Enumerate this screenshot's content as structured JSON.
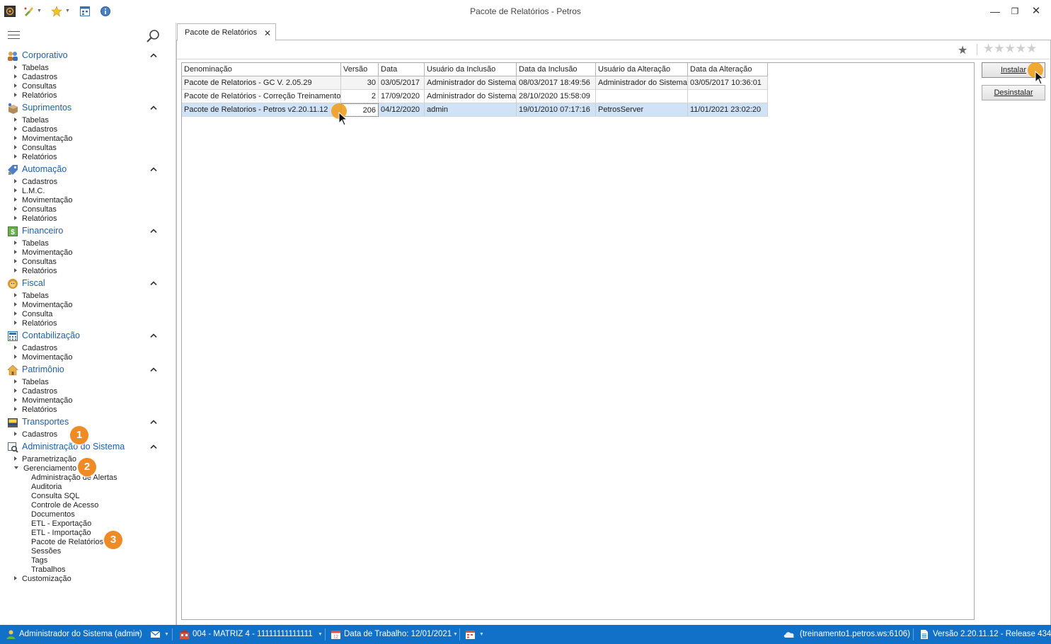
{
  "window": {
    "title": "Pacote de Relatórios - Petros"
  },
  "toolbar": {
    "icons": [
      "app-logo-icon",
      "brush-icon",
      "favorites-star-icon",
      "calendar-grid-icon",
      "info-icon"
    ]
  },
  "sidebar": {
    "groups": [
      {
        "name": "corporativo",
        "label": "Corporativo",
        "icon": "people-icon",
        "items": [
          "Tabelas",
          "Cadastros",
          "Consultas",
          "Relatórios"
        ]
      },
      {
        "name": "suprimentos",
        "label": "Suprimentos",
        "icon": "box-icon",
        "items": [
          "Tabelas",
          "Cadastros",
          "Movimentação",
          "Consultas",
          "Relatórios"
        ]
      },
      {
        "name": "automacao",
        "label": "Automação",
        "icon": "tag-icon",
        "items": [
          "Cadastros",
          "L.M.C.",
          "Movimentação",
          "Consultas",
          "Relatórios"
        ]
      },
      {
        "name": "financeiro",
        "label": "Financeiro",
        "icon": "money-icon",
        "items": [
          "Tabelas",
          "Movimentação",
          "Consultas",
          "Relatórios"
        ]
      },
      {
        "name": "fiscal",
        "label": "Fiscal",
        "icon": "lion-icon",
        "items": [
          "Tabelas",
          "Movimentação",
          "Consulta",
          "Relatórios"
        ]
      },
      {
        "name": "contabilizacao",
        "label": "Contabilização",
        "icon": "calculator-icon",
        "items": [
          "Cadastros",
          "Movimentação"
        ]
      },
      {
        "name": "patrimonio",
        "label": "Patrimônio",
        "icon": "house-icon",
        "items": [
          "Tabelas",
          "Cadastros",
          "Movimentação",
          "Relatórios"
        ]
      },
      {
        "name": "transportes",
        "label": "Transportes",
        "icon": "truck-icon",
        "items": [
          "Cadastros"
        ]
      },
      {
        "name": "administracao",
        "label": "Administração do Sistema",
        "icon": "wrench-icon",
        "items": [
          "Parametrização",
          "Gerenciamento"
        ]
      }
    ],
    "gerenciamento_children": [
      "Administração de Alertas",
      "Auditoria",
      "Consulta SQL",
      "Controle de Acesso",
      "Documentos",
      "ETL - Exportação",
      "ETL - Importação",
      "Pacote de Relatórios",
      "Sessões",
      "Tags",
      "Trabalhos"
    ],
    "last_item": "Customização",
    "steps": [
      "1",
      "2",
      "3"
    ]
  },
  "tab": {
    "label": "Pacote de Relatórios"
  },
  "grid": {
    "columns": [
      "Denominação",
      "Versão",
      "Data",
      "Usuário da Inclusão",
      "Data da Inclusão",
      "Usuário da Alteração",
      "Data da Alteração"
    ],
    "rows": [
      [
        "Pacote de Relatorios - GC V. 2.05.29",
        "30",
        "03/05/2017",
        "Administrador do Sistema",
        "08/03/2017 18:49:56",
        "Administrador do Sistema",
        "03/05/2017 10:36:01"
      ],
      [
        "Pacote de Relatórios - Correção Treinamento",
        "2",
        "17/09/2020",
        "Administrador do Sistema",
        "28/10/2020 15:58:09",
        "",
        ""
      ],
      [
        "Pacote de Relatorios - Petros v2.20.11.12",
        "206",
        "04/12/2020",
        "admin",
        "19/01/2010 07:17:16",
        "PetrosServer",
        "11/01/2021 23:02:20"
      ]
    ],
    "selected_row": 2
  },
  "actions": {
    "install": "Instalar",
    "uninstall": "Desinstalar"
  },
  "rating": {
    "stars": "★★★★★",
    "favorite": "★"
  },
  "statusbar": {
    "user": "Administrador do Sistema (admin)",
    "company": "004 - MATRIZ 4 - 11111111111111",
    "work_date": "Data de Trabalho: 12/01/2021",
    "server": "(treinamento1.petros.ws:6106)",
    "version": "Versão 2.20.11.12 - Release 434"
  },
  "colors": {
    "accent": "#1f5fa8",
    "statusbar": "#1170c7",
    "selection": "#cfe2f6",
    "badge": "#f08a24"
  }
}
